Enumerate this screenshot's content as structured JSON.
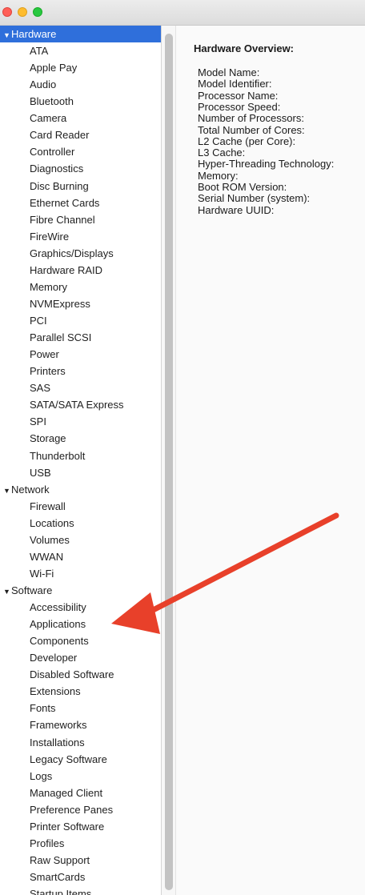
{
  "sidebar": {
    "categories": [
      {
        "label": "Hardware",
        "items": [
          "ATA",
          "Apple Pay",
          "Audio",
          "Bluetooth",
          "Camera",
          "Card Reader",
          "Controller",
          "Diagnostics",
          "Disc Burning",
          "Ethernet Cards",
          "Fibre Channel",
          "FireWire",
          "Graphics/Displays",
          "Hardware RAID",
          "Memory",
          "NVMExpress",
          "PCI",
          "Parallel SCSI",
          "Power",
          "Printers",
          "SAS",
          "SATA/SATA Express",
          "SPI",
          "Storage",
          "Thunderbolt",
          "USB"
        ]
      },
      {
        "label": "Network",
        "items": [
          "Firewall",
          "Locations",
          "Volumes",
          "WWAN",
          "Wi-Fi"
        ]
      },
      {
        "label": "Software",
        "items": [
          "Accessibility",
          "Applications",
          "Components",
          "Developer",
          "Disabled Software",
          "Extensions",
          "Fonts",
          "Frameworks",
          "Installations",
          "Legacy Software",
          "Logs",
          "Managed Client",
          "Preference Panes",
          "Printer Software",
          "Profiles",
          "Raw Support",
          "SmartCards",
          "Startup Items"
        ]
      }
    ]
  },
  "content": {
    "title": "Hardware Overview:",
    "fields": [
      "Model Name:",
      "Model Identifier:",
      "Processor Name:",
      "Processor Speed:",
      "Number of Processors:",
      "Total Number of Cores:",
      "L2 Cache (per Core):",
      "L3 Cache:",
      "Hyper-Threading Technology:",
      "Memory:",
      "Boot ROM Version:",
      "Serial Number (system):",
      "Hardware UUID:"
    ]
  },
  "colors": {
    "selection": "#2f6fdb",
    "arrow": "#e8402a"
  },
  "icons": {
    "expanded": "▼"
  }
}
